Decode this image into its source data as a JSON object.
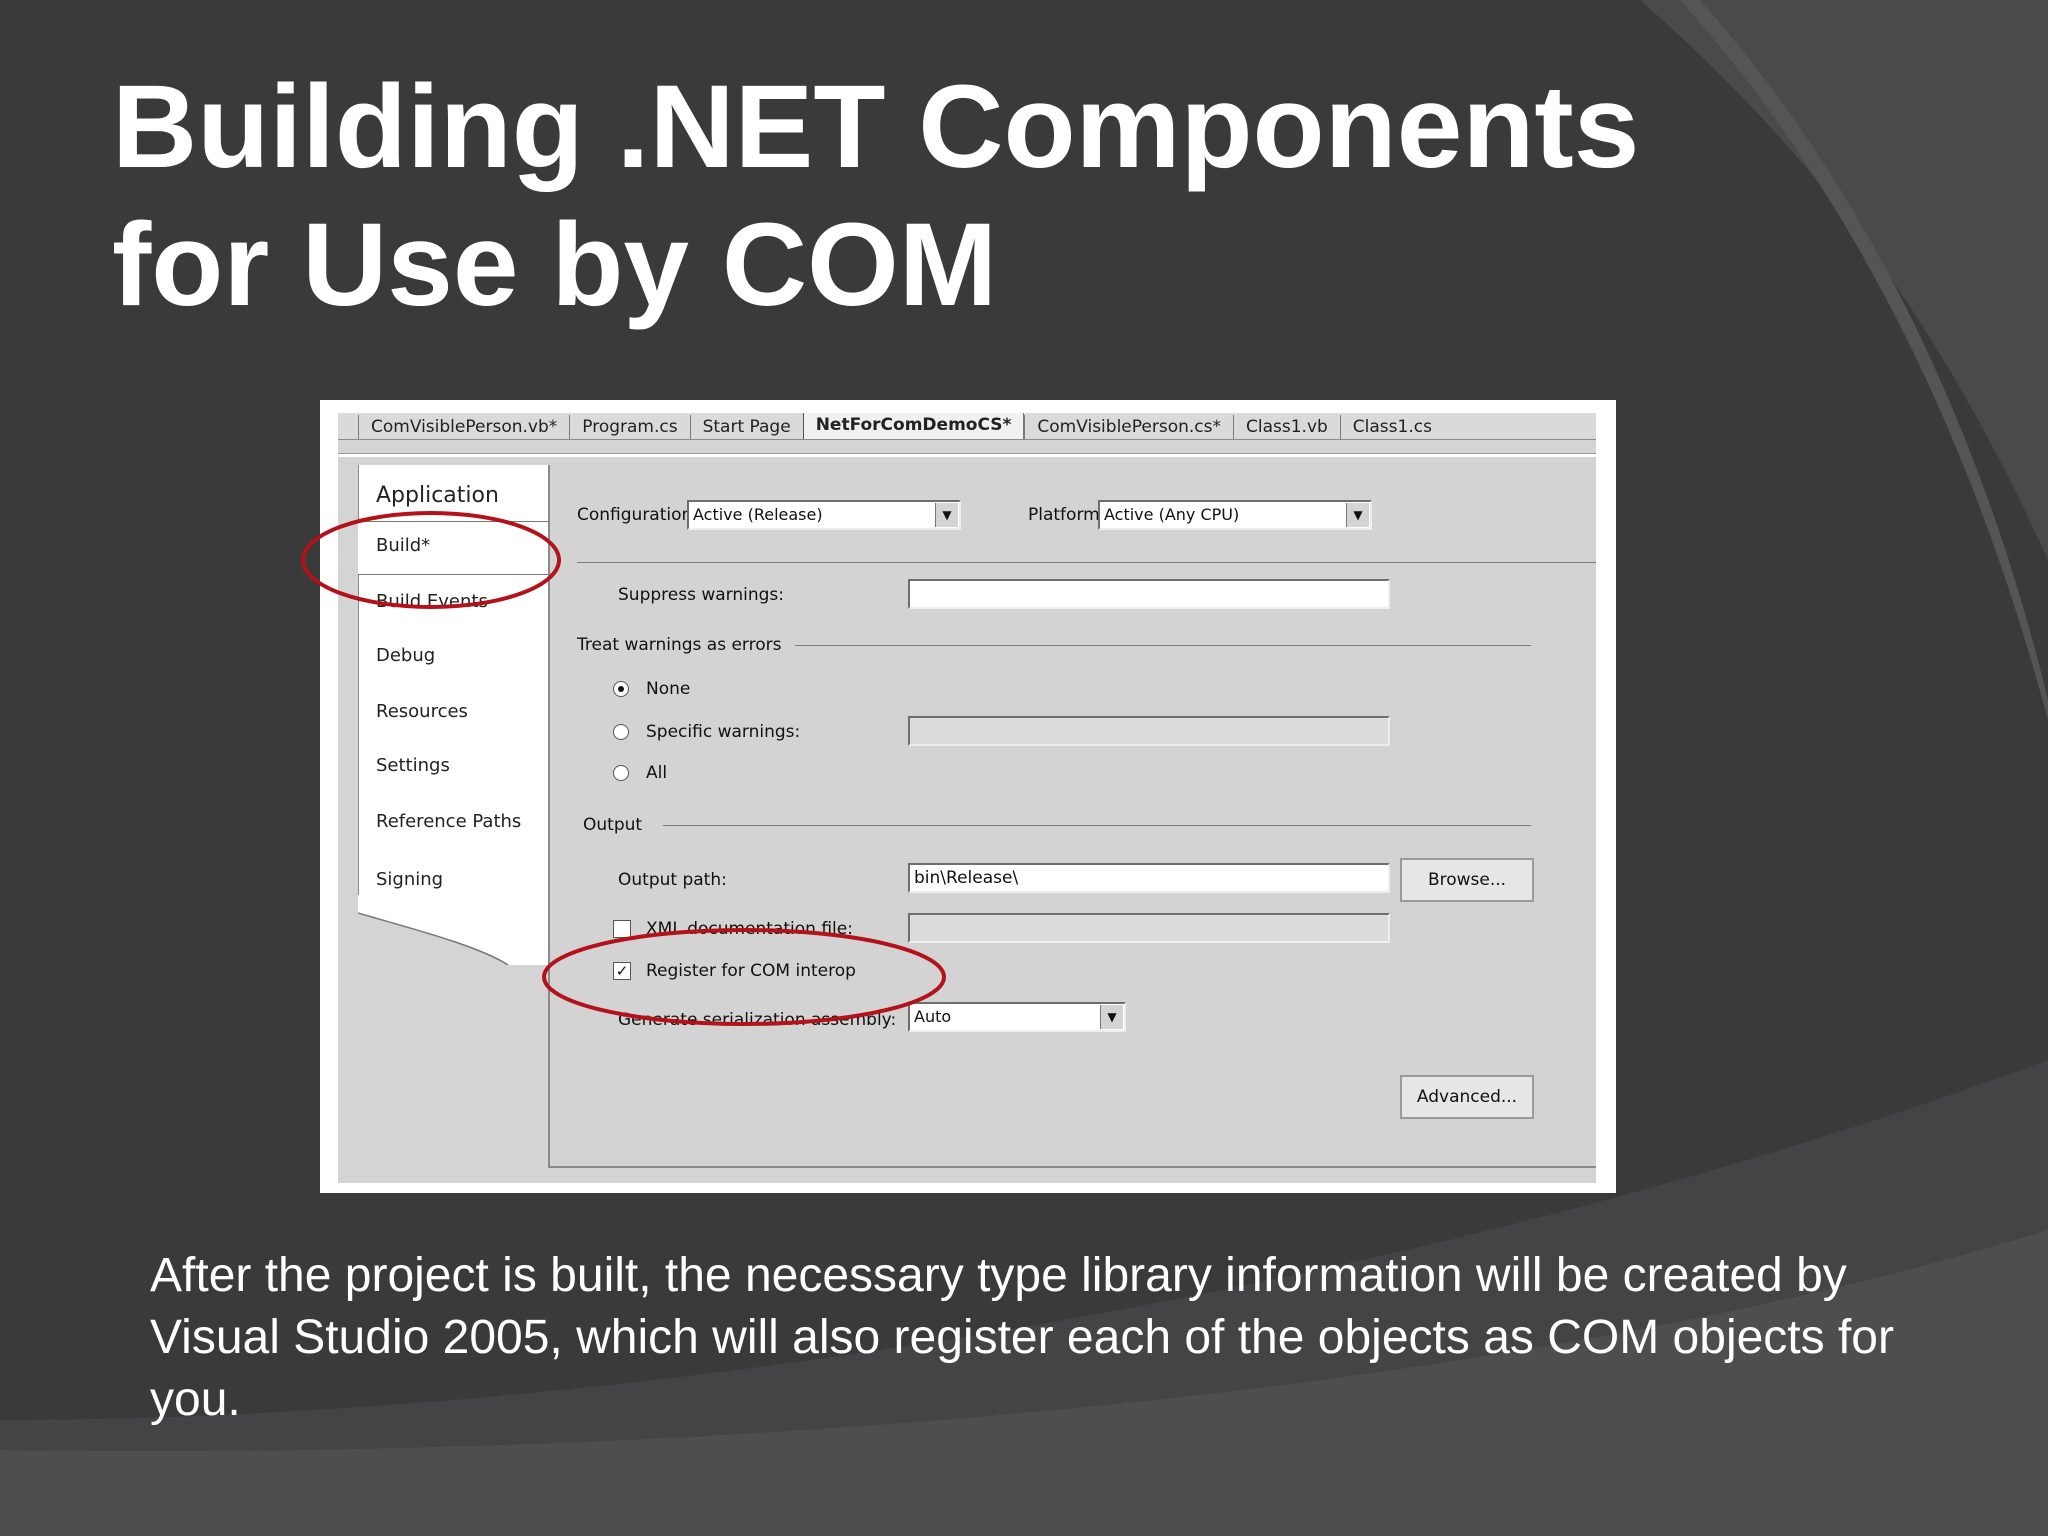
{
  "slide": {
    "title_line1": "Building .NET Components",
    "title_line2": "for Use by COM",
    "body": "After the project is built, the necessary type library information will be created by Visual Studio 2005, which will also register each of the objects as COM objects for you."
  },
  "tabs": [
    {
      "label": "ComVisiblePerson.vb*",
      "active": false
    },
    {
      "label": "Program.cs",
      "active": false
    },
    {
      "label": "Start Page",
      "active": false
    },
    {
      "label": "NetForComDemoCS*",
      "active": true
    },
    {
      "label": "ComVisiblePerson.cs*",
      "active": false
    },
    {
      "label": "Class1.vb",
      "active": false
    },
    {
      "label": "Class1.cs",
      "active": false
    }
  ],
  "nav": {
    "items": [
      "Application",
      "Build*",
      "Build Events",
      "Debug",
      "Resources",
      "Settings",
      "Reference Paths",
      "Signing"
    ],
    "selected": "Build*"
  },
  "build": {
    "configuration_label": "Configuration:",
    "configuration_value": "Active (Release)",
    "platform_label": "Platform:",
    "platform_value": "Active (Any CPU)",
    "suppress_label": "Suppress warnings:",
    "suppress_value": "",
    "treat_group": "Treat warnings as errors",
    "radio_none": "None",
    "radio_specific": "Specific warnings:",
    "radio_all": "All",
    "specific_value": "",
    "output_group": "Output",
    "output_path_label": "Output path:",
    "output_path_value": "bin\\Release\\",
    "browse_label": "Browse...",
    "xml_doc_label": "XML documentation file:",
    "xml_doc_value": "",
    "register_label": "Register for COM interop",
    "register_checked": true,
    "serialization_label": "Generate serialization assembly:",
    "serialization_value": "Auto",
    "advanced_label": "Advanced..."
  },
  "colors": {
    "slide_background": "#3a3a3b",
    "annotation_red": "#b3121a"
  },
  "icons": {
    "dropdown": "chevron-down-icon",
    "checkmark": "check-icon"
  }
}
